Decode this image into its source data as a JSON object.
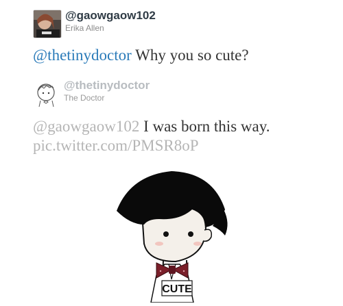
{
  "tweet1": {
    "handle": "@gaowgaow102",
    "name": "Erika Allen",
    "mention": "@thetinydoctor",
    "text": " Why you so cute?",
    "avatar_icon": "user-photo-avatar"
  },
  "tweet2": {
    "handle": "@thetinydoctor",
    "name": "The Doctor",
    "mention": "@gaowgaow102",
    "text": " I was born this way.",
    "link": "pic.twitter.com/PMSR8oP",
    "avatar_icon": "doctor-sketch-avatar"
  },
  "illustration": {
    "label": "CUTE",
    "hair_color": "#0a0a0a",
    "bowtie_color": "#7a1f2a",
    "skin_color": "#f4f0ea"
  }
}
